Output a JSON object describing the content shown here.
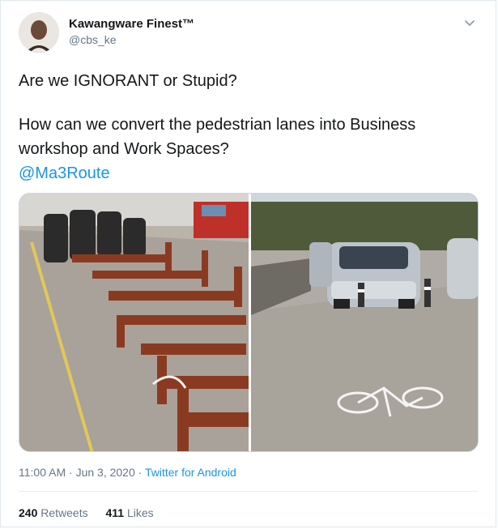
{
  "user": {
    "display_name": "Kawangware Finest™",
    "handle": "@cbs_ke"
  },
  "tweet": {
    "line1": "Are we IGNORANT or Stupid?",
    "line2": "How can we convert the pedestrian lanes into Business workshop and Work Spaces?",
    "mention": "@Ma3Route"
  },
  "meta": {
    "time": "11:00 AM",
    "separator1": " · ",
    "date": "Jun 3, 2020",
    "separator2": " · ",
    "source": "Twitter for Android"
  },
  "stats": {
    "retweets_count": "240",
    "retweets_label": "Retweets",
    "likes_count": "411",
    "likes_label": "Likes"
  },
  "icons": {
    "chevron": "chevron-down-icon",
    "avatar": "avatar"
  },
  "colors": {
    "link": "#1b95e0",
    "secondary_text": "#657786",
    "primary_text": "#14171a",
    "border": "#e1e8ed"
  }
}
